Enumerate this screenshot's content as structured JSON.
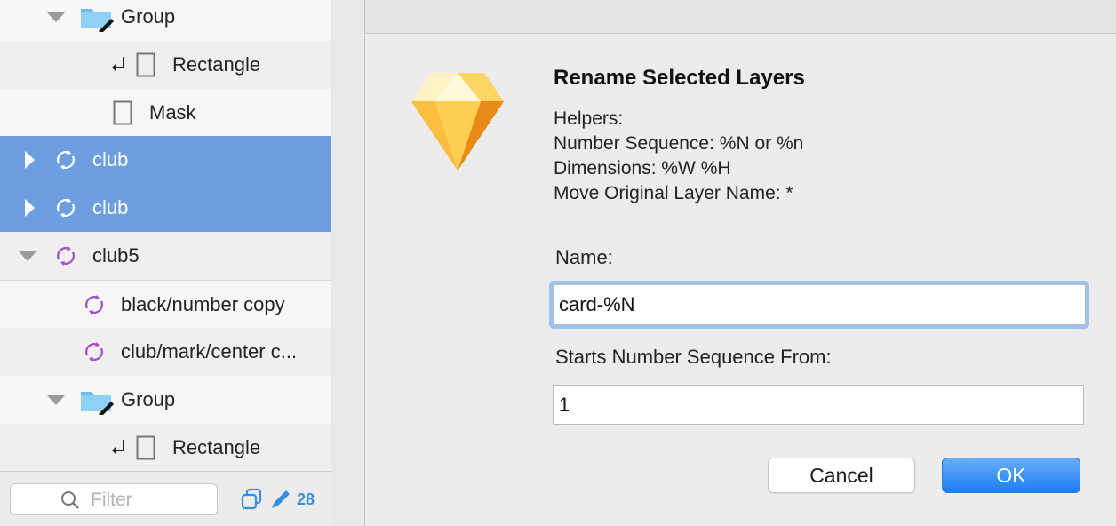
{
  "layers": {
    "rows": [
      {
        "label": "Group",
        "kind": "group"
      },
      {
        "label": "Rectangle",
        "kind": "rectangle"
      },
      {
        "label": "Mask",
        "kind": "mask"
      },
      {
        "label": "club",
        "kind": "symbol"
      },
      {
        "label": "club",
        "kind": "symbol"
      },
      {
        "label": "club5",
        "kind": "symbol"
      },
      {
        "label": "black/number copy",
        "kind": "symbol"
      },
      {
        "label": "club/mark/center c...",
        "kind": "symbol"
      },
      {
        "label": "Group",
        "kind": "group"
      },
      {
        "label": "Rectangle",
        "kind": "rectangle"
      }
    ],
    "filter_placeholder": "Filter",
    "count": "28"
  },
  "dialog": {
    "title": "Rename Selected Layers",
    "helpers": [
      "Helpers:",
      "Number Sequence: %N or %n",
      "Dimensions: %W %H",
      "Move Original Layer Name: *"
    ],
    "name_label": "Name:",
    "name_value": "card-%N",
    "start_label": "Starts Number Sequence From:",
    "start_value": "1",
    "cancel_label": "Cancel",
    "ok_label": "OK"
  },
  "colors": {
    "selection": "#6c9ee0",
    "symbol_purple": "#a24fc9",
    "folder_blue": "#6bbdf2",
    "primary_button": "#1c7ff3",
    "focus_ring": "#9cc2ee",
    "accent_blue": "#3b8de0"
  }
}
